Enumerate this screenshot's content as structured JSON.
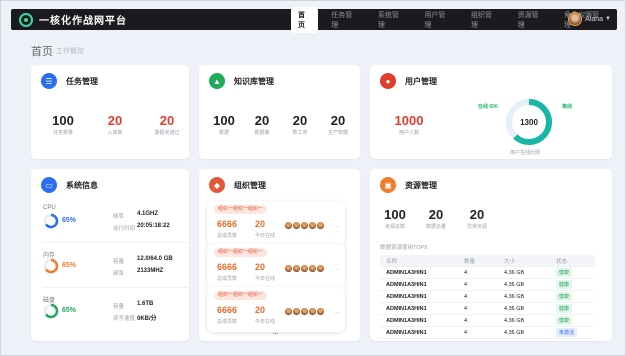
{
  "app": {
    "title": "一核化作战网平台",
    "user_name": "Alana"
  },
  "nav": [
    "首页",
    "任务管理",
    "系统管理",
    "用户管理",
    "组织管理",
    "资源管理",
    "角色权限管理"
  ],
  "page": {
    "title": "首页",
    "subtitle": "工作概览"
  },
  "colors": {
    "blue": "#2b6ef2",
    "green": "#1faa5c",
    "red": "#e13d2d",
    "orange": "#f07c2c",
    "teal": "#19b6a6"
  },
  "task": {
    "title": "任务管理",
    "icon": "task-icon",
    "stats": [
      {
        "value": "100",
        "label": "任务数量"
      },
      {
        "value": "20",
        "label": "入库数"
      },
      {
        "value": "20",
        "label": "警报未通过"
      }
    ]
  },
  "mine": {
    "title": "知识库管理",
    "icon": "graduation-cap-icon",
    "stats": [
      {
        "value": "100",
        "label": "数据"
      },
      {
        "value": "20",
        "label": "数据量"
      },
      {
        "value": "20",
        "label": "数工序"
      },
      {
        "value": "20",
        "label": "生产数据"
      }
    ]
  },
  "users": {
    "title": "用户管理",
    "icon": "user-icon",
    "total": {
      "value": "1000",
      "label": "用户人数"
    },
    "donut": {
      "center": "1300",
      "caption": "用户在线比例",
      "left_tag": "在线  600",
      "right_tag": "离线",
      "online_fraction": 0.62
    }
  },
  "system": {
    "title": "系统信息",
    "icon": "monitor-icon",
    "rows": [
      {
        "name": "CPU",
        "percent": "65%",
        "fraction": 0.65,
        "color": "#2b6ef2",
        "k1": "频率",
        "v1": "4.1GHZ",
        "k2": "运行时间",
        "v2": "20:05:18:22"
      },
      {
        "name": "内存",
        "percent": "65%",
        "fraction": 0.65,
        "color": "#f07c2c",
        "k1": "容量",
        "v1": "12.0/64.0 GB",
        "k2": "频率",
        "v2": "2133MHZ"
      },
      {
        "name": "磁盘",
        "percent": "65%",
        "fraction": 0.65,
        "color": "#1faa5c",
        "k1": "容量",
        "v1": "1.6TB",
        "k2": "读写速度",
        "v2": "0KB/分"
      }
    ]
  },
  "org": {
    "title": "组织管理",
    "icon": "org-icon",
    "items": [
      {
        "tag": "组织一组织一组织一",
        "n1": "6666",
        "l1": "总成员数",
        "n2": "20",
        "l2": "今日在线"
      },
      {
        "tag": "组织一组织一组织一",
        "n1": "6666",
        "l1": "总成员数",
        "n2": "20",
        "l2": "今日在线"
      },
      {
        "tag": "组织一组织一组织一",
        "n1": "6666",
        "l1": "总成员数",
        "n2": "20",
        "l2": "今日在线"
      }
    ],
    "more": "..."
  },
  "resource": {
    "title": "资源管理",
    "icon": "resource-icon",
    "stats": [
      {
        "value": "100",
        "label": "资源总数"
      },
      {
        "value": "20",
        "label": "数据总量"
      },
      {
        "value": "20",
        "label": "异常资源"
      }
    ],
    "table_caption": "数据资源使用TOP8",
    "headers": [
      "名称",
      "数量",
      "大小",
      "状态"
    ],
    "rows": [
      {
        "name": "ADMIN1A3HIN1",
        "count": "4",
        "size": "4.36 GB",
        "status": "健康",
        "status_color": "#1faa5c"
      },
      {
        "name": "ADMIN1A3HIN1",
        "count": "4",
        "size": "4.36 GB",
        "status": "健康",
        "status_color": "#1faa5c"
      },
      {
        "name": "ADMIN1A3HIN1",
        "count": "4",
        "size": "4.36 GB",
        "status": "健康",
        "status_color": "#1faa5c"
      },
      {
        "name": "ADMIN1A3HIN1",
        "count": "4",
        "size": "4.36 GB",
        "status": "健康",
        "status_color": "#1faa5c"
      },
      {
        "name": "ADMIN1A3HIN1",
        "count": "4",
        "size": "4.36 GB",
        "status": "健康",
        "status_color": "#1faa5c"
      },
      {
        "name": "ADMIN1A3HIN1",
        "count": "4",
        "size": "4.36 GB",
        "status": "未激活",
        "status_color": "#2b6ef2"
      }
    ]
  }
}
